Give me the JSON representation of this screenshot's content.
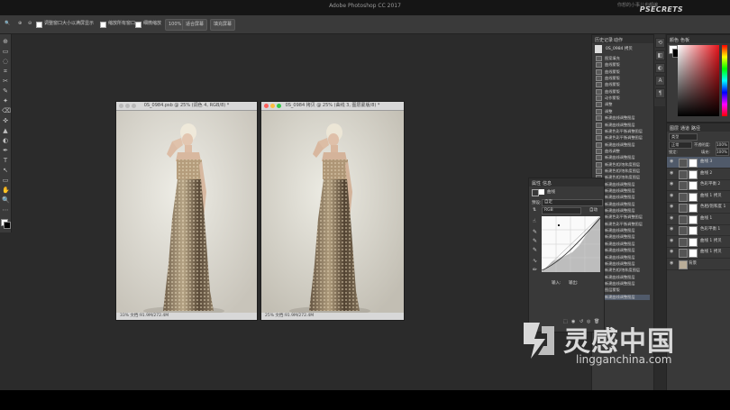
{
  "window": {
    "title": "Adobe Photoshop CC 2017",
    "watermark_cn": "你想的小事儿也都编",
    "brand": "PSECRETS"
  },
  "options_bar": {
    "check1_label": "调整窗口大小以满屏显示",
    "check2_label": "缩放所有窗口",
    "check3_label": "细微缩放",
    "zoom_value": "100%",
    "fit_screen": "适合屏幕",
    "fill_screen": "填充屏幕"
  },
  "tools": [
    "⊕",
    "▭",
    "◌",
    "⌗",
    "✂",
    "✎",
    "✦",
    "⌫",
    "✜",
    "▲",
    "◐",
    "✒",
    "T",
    "↖",
    "▭",
    "✋",
    "🔍",
    "⋯"
  ],
  "documents": [
    {
      "title": "0S_0984.psb @ 25% (调色 4, RGB/8) *",
      "status": "33%   文档:91.9M/272.4M"
    },
    {
      "title": "0S_0984 拷贝 @ 25% (曲线 3, 图层蒙版/8) *",
      "status": "25%   文档:91.9M/272.4M"
    }
  ],
  "history_panel": {
    "tabs": [
      "历史记录",
      "动作"
    ],
    "snapshot": "0S_0984 拷贝",
    "items": [
      "图案填充",
      "曲线蒙版",
      "曲线蒙版",
      "曲线蒙版",
      "曲线蒙版",
      "曲线蒙版",
      "动作蒙版",
      "调整",
      "调整",
      "新建曲线调整图层",
      "新建曲线调整图层",
      "新建色彩平衡调整图层",
      "新建色彩平衡调整图层",
      "新建曲线调整图层",
      "曲线调整",
      "新建曲线调整图层",
      "新建色相/饱和度图层",
      "新建色相/饱和度图层",
      "新建色相/饱和度图层",
      "新建曲线调整图层",
      "新建曲线调整图层",
      "新建曲线调整图层",
      "新建曲线调整图层",
      "新建曲线调整图层",
      "新建色彩平衡调整图层",
      "新建色彩平衡调整图层",
      "新建曲线调整图层",
      "新建曲线调整图层",
      "新建曲线调整图层",
      "新建曲线调整图层",
      "新建曲线调整图层",
      "新建曲线调整图层",
      "新建色相/饱和度图层",
      "新建曲线调整图层",
      "新建曲线调整图层",
      "图层蒙版",
      "新建曲线调整图层"
    ]
  },
  "properties_panel": {
    "tabs": [
      "属性",
      "信息"
    ],
    "adj_name": "曲线",
    "preset_label": "预设:",
    "preset_value": "自定",
    "channel_value": "RGB",
    "auto_label": "自动",
    "input_label": "输入:",
    "output_label": "输出:"
  },
  "color_panel": {
    "tabs": [
      "颜色",
      "色板"
    ]
  },
  "layers_panel": {
    "tabs": [
      "图层",
      "通道",
      "路径"
    ],
    "kind_label": "类型",
    "blend_mode": "正常",
    "opacity_label": "不透明度:",
    "opacity_value": "100%",
    "lock_label": "锁定:",
    "fill_label": "填充:",
    "fill_value": "100%",
    "layers": [
      {
        "name": "曲线 3"
      },
      {
        "name": "曲线 2"
      },
      {
        "name": "色彩平衡 2"
      },
      {
        "name": "曲线 1 拷贝"
      },
      {
        "name": "色相/饱和度 1"
      },
      {
        "name": "曲线 1"
      },
      {
        "name": "色彩平衡 1"
      },
      {
        "name": "曲线 1 拷贝"
      },
      {
        "name": "曲线 1 拷贝"
      },
      {
        "name": "背景"
      }
    ]
  },
  "logo": {
    "text": "灵感中国",
    "url": "lingganchina.com"
  }
}
